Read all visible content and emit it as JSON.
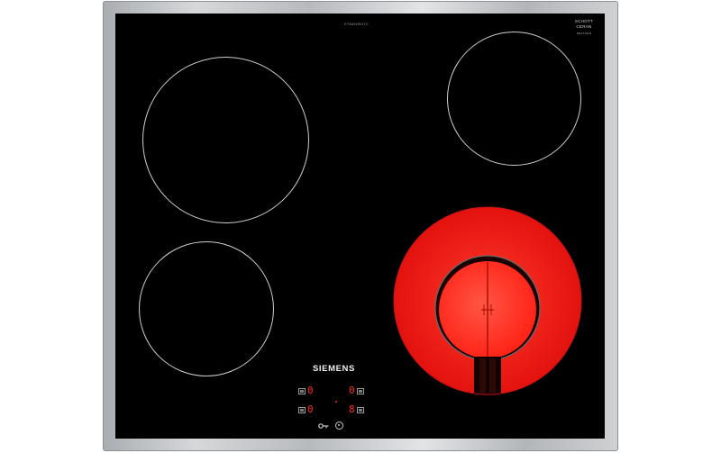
{
  "hob": {
    "model_code": "ET645HN17C",
    "brand": "SIEMENS",
    "glass_maker_line1": "SCHOTT",
    "glass_maker_line2": "CERAN",
    "glass_note": "NEXTGEN",
    "zones": [
      {
        "name": "rear-left",
        "state": "off"
      },
      {
        "name": "rear-right",
        "state": "off"
      },
      {
        "name": "front-left",
        "state": "off"
      },
      {
        "name": "front-right",
        "state": "glowing",
        "glow_color": "#ff1e1e"
      }
    ],
    "displays": {
      "rear_left": "0",
      "rear_right": "0",
      "front_left": "0",
      "front_right": "8"
    },
    "colors": {
      "glass": "#000000",
      "frame": "#c4c7ca",
      "display_red": "#ff2a2a",
      "ring_line": "#cfcfcf"
    },
    "icons": [
      "key-lock-icon",
      "power-icon",
      "sensor-icon"
    ]
  }
}
